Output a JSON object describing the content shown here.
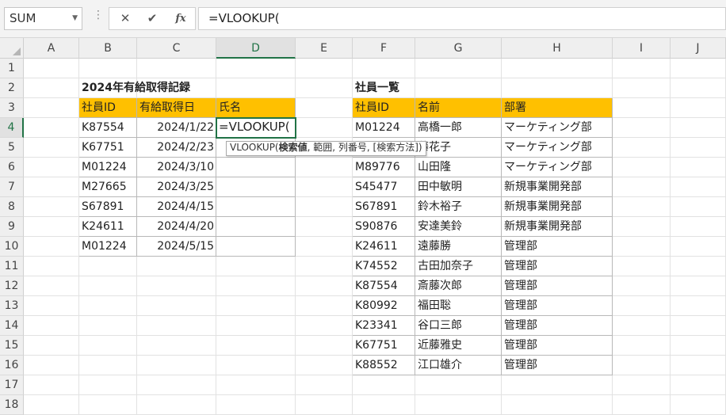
{
  "namebox": {
    "value": "SUM"
  },
  "formula_bar": {
    "cancel_glyph": "✕",
    "enter_glyph": "✔",
    "fx_label": "fx",
    "formula": "=VLOOKUP("
  },
  "columns": [
    "A",
    "B",
    "C",
    "D",
    "E",
    "F",
    "G",
    "H",
    "I",
    "J"
  ],
  "rows": [
    "1",
    "2",
    "3",
    "4",
    "5",
    "6",
    "7",
    "8",
    "9",
    "10",
    "11",
    "12",
    "13",
    "14",
    "15",
    "16",
    "17",
    "18"
  ],
  "selected": {
    "column": "D",
    "row": "4"
  },
  "record": {
    "title": "2024年有給取得記録",
    "headers": [
      "社員ID",
      "有給取得日",
      "氏名"
    ],
    "rows": [
      [
        "K87554",
        "2024/1/22"
      ],
      [
        "K67751",
        "2024/2/23"
      ],
      [
        "M01224",
        "2024/3/10"
      ],
      [
        "M27665",
        "2024/3/25"
      ],
      [
        "S67891",
        "2024/4/15"
      ],
      [
        "K24611",
        "2024/4/20"
      ],
      [
        "M01224",
        "2024/5/15"
      ]
    ],
    "editing_cell": "=VLOOKUP("
  },
  "tooltip": {
    "func": "VLOOKUP(",
    "arg1": "検索値",
    "rest": ", 範囲, 列番号, [検索方法])"
  },
  "employees": {
    "title": "社員一覧",
    "headers": [
      "社員ID",
      "名前",
      "部署"
    ],
    "rows": [
      [
        "M01224",
        "高橋一郎",
        "マーケティング部"
      ],
      [
        "",
        "藤花子",
        "マーケティング部"
      ],
      [
        "M89776",
        "山田隆",
        "マーケティング部"
      ],
      [
        "S45477",
        "田中敏明",
        "新規事業開発部"
      ],
      [
        "S67891",
        "鈴木裕子",
        "新規事業開発部"
      ],
      [
        "S90876",
        "安達美鈴",
        "新規事業開発部"
      ],
      [
        "K24611",
        "遠藤勝",
        "管理部"
      ],
      [
        "K74552",
        "古田加奈子",
        "管理部"
      ],
      [
        "K87554",
        "斎藤次郎",
        "管理部"
      ],
      [
        "K80992",
        "福田聡",
        "管理部"
      ],
      [
        "K23341",
        "谷口三郎",
        "管理部"
      ],
      [
        "K67751",
        "近藤雅史",
        "管理部"
      ],
      [
        "K88552",
        "江口雄介",
        "管理部"
      ]
    ]
  },
  "colors": {
    "accent": "#217346",
    "header_fill": "#ffc000"
  }
}
